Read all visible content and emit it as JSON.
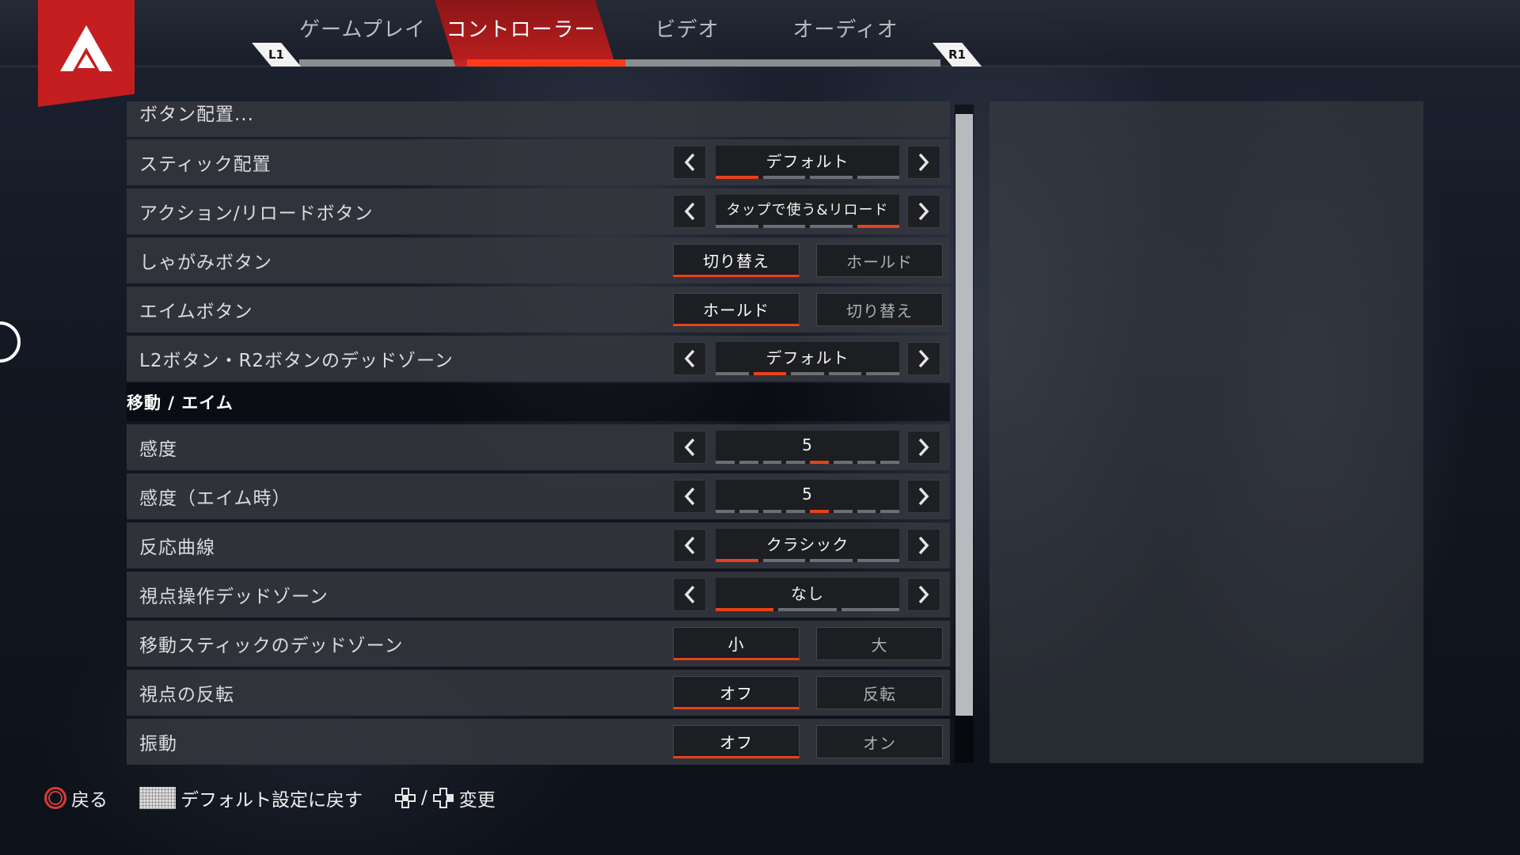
{
  "tabs": {
    "left_shoulder": "L1",
    "right_shoulder": "R1",
    "items": [
      {
        "label": "ゲームプレイ"
      },
      {
        "label": "コントローラー"
      },
      {
        "label": "ビデオ"
      },
      {
        "label": "オーディオ"
      }
    ],
    "active_index": 1
  },
  "settings": {
    "button_layout": "ボタン配置...",
    "stick_layout": {
      "label": "スティック配置",
      "value": "デフォルト",
      "segments": 4,
      "selected_segment": 1
    },
    "action_reload": {
      "label": "アクション/リロードボタン",
      "value": "タップで使う&リロード",
      "segments": 4,
      "selected_segment": 4
    },
    "crouch": {
      "label": "しゃがみボタン",
      "option_a": "切り替え",
      "option_b": "ホールド",
      "selected": "a"
    },
    "aim": {
      "label": "エイムボタン",
      "option_a": "ホールド",
      "option_b": "切り替え",
      "selected": "a"
    },
    "trigger_deadzone": {
      "label": "L2ボタン・R2ボタンのデッドゾーン",
      "value": "デフォルト",
      "segments": 5,
      "selected_segment": 2
    },
    "section_movement": "移動 / エイム",
    "sensitivity": {
      "label": "感度",
      "value": "5",
      "segments": 8,
      "selected_segment": 5
    },
    "ads_sensitivity": {
      "label": "感度（エイム時）",
      "value": "5",
      "segments": 8,
      "selected_segment": 5
    },
    "response_curve": {
      "label": "反応曲線",
      "value": "クラシック",
      "segments": 4,
      "selected_segment": 1
    },
    "look_deadzone": {
      "label": "視点操作デッドゾーン",
      "value": "なし",
      "segments": 3,
      "selected_segment": 1
    },
    "move_deadzone": {
      "label": "移動スティックのデッドゾーン",
      "option_a": "小",
      "option_b": "大",
      "selected": "a"
    },
    "invert_look": {
      "label": "視点の反転",
      "option_a": "オフ",
      "option_b": "反転",
      "selected": "a"
    },
    "vibration": {
      "label": "振動",
      "option_a": "オフ",
      "option_b": "オン",
      "selected": "a"
    }
  },
  "footer": {
    "back_label": "戻る",
    "back_icon": "circle-button-icon",
    "reset_label": "デフォルト設定に戻す",
    "reset_icon": "touchpad-button-icon",
    "change_separator": "/",
    "change_label": "変更",
    "change_icon": "dpad-icon"
  },
  "colors": {
    "accent": "#e8401c",
    "logo_red": "#c41e21",
    "row_bg": "#34373d"
  }
}
